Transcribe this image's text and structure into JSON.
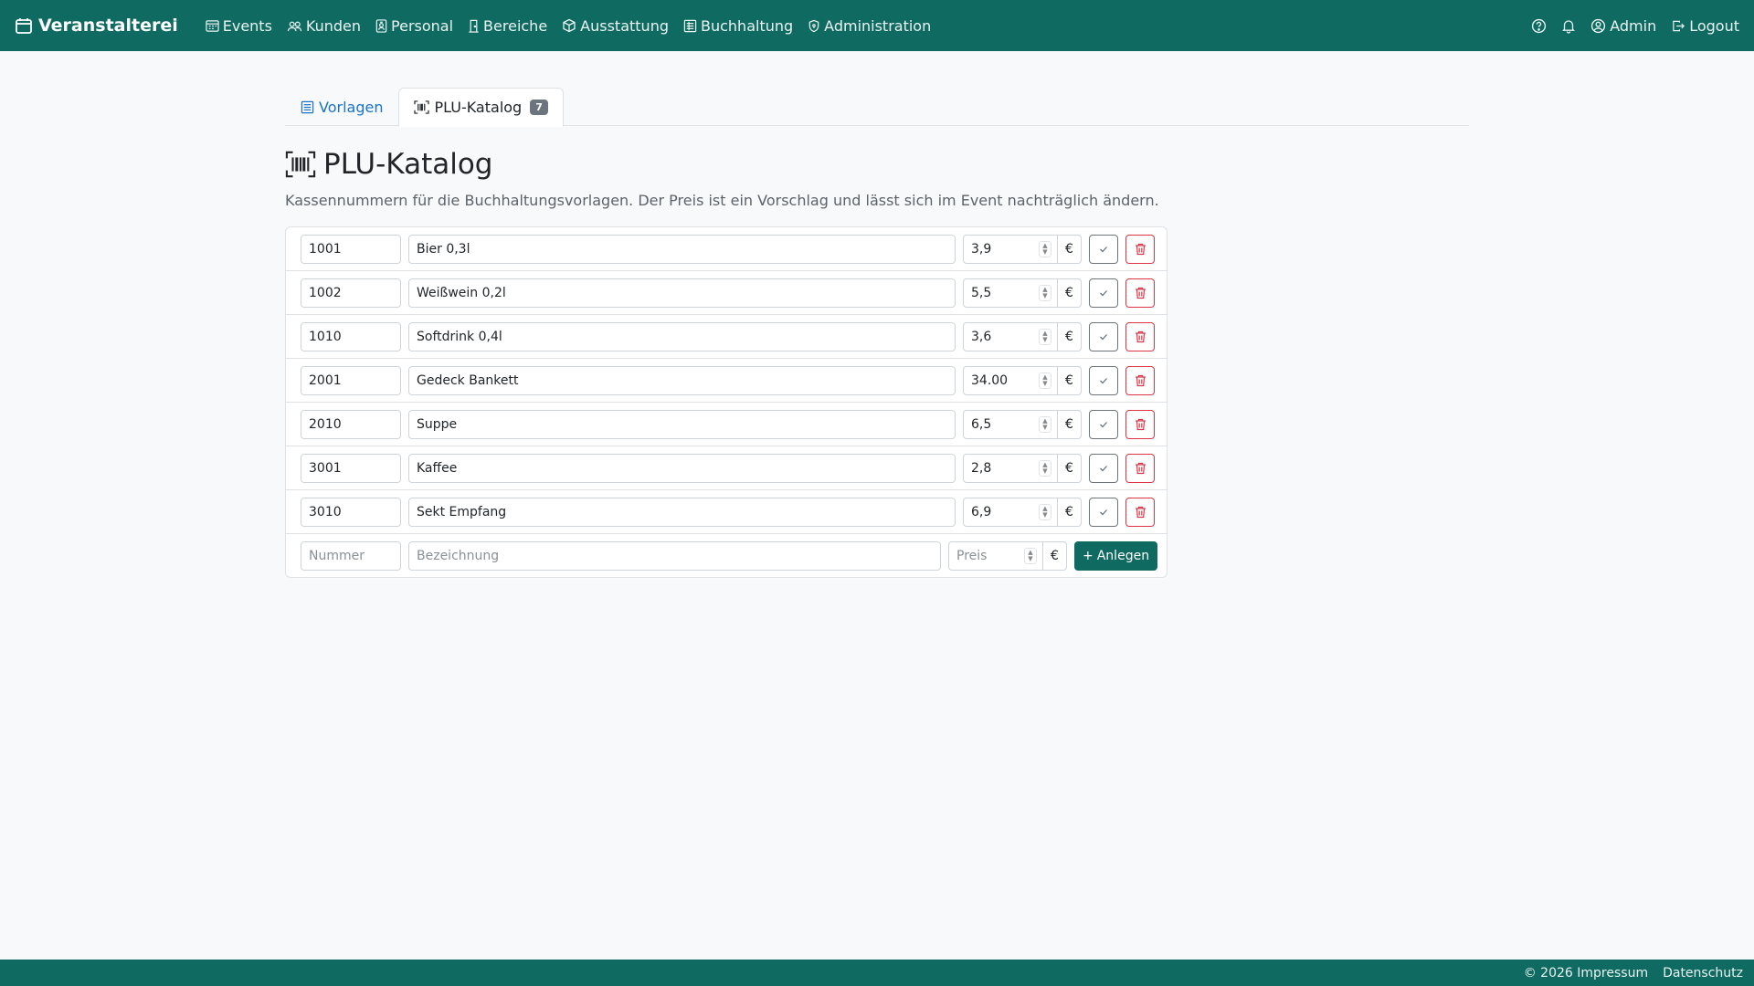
{
  "app": {
    "brand": "Veranstalterei",
    "accent_color": "#0f6b61"
  },
  "nav": {
    "items": [
      {
        "label": "Events",
        "icon": "calendar-grid-icon"
      },
      {
        "label": "Kunden",
        "icon": "people-icon"
      },
      {
        "label": "Personal",
        "icon": "badge-icon"
      },
      {
        "label": "Bereiche",
        "icon": "door-icon"
      },
      {
        "label": "Ausstattung",
        "icon": "box-icon"
      },
      {
        "label": "Buchhaltung",
        "icon": "ledger-icon"
      },
      {
        "label": "Administration",
        "icon": "shield-icon"
      }
    ],
    "user": "Admin",
    "logout": "Logout"
  },
  "tabs": {
    "vorlagen": "Vorlagen",
    "plu": "PLU-Katalog",
    "plu_count": "7"
  },
  "page": {
    "title": "PLU-Katalog",
    "subtitle": "Kassennummern für die Buchhaltungsvorlagen. Der Preis ist ein Vorschlag und lässt sich im Event nachträglich ändern."
  },
  "rows": [
    {
      "number": "1001",
      "name": "Bier 0,3l",
      "price": "3,9",
      "currency": "€"
    },
    {
      "number": "1002",
      "name": "Weißwein 0,2l",
      "price": "5,5",
      "currency": "€"
    },
    {
      "number": "1010",
      "name": "Softdrink 0,4l",
      "price": "3,6",
      "currency": "€"
    },
    {
      "number": "2001",
      "name": "Gedeck Bankett",
      "price": "34.00",
      "currency": "€"
    },
    {
      "number": "2010",
      "name": "Suppe",
      "price": "6,5",
      "currency": "€"
    },
    {
      "number": "3001",
      "name": "Kaffee",
      "price": "2,8",
      "currency": "€"
    },
    {
      "number": "3010",
      "name": "Sekt Empfang",
      "price": "6,9",
      "currency": "€"
    }
  ],
  "new_row": {
    "number_placeholder": "Nummer",
    "name_placeholder": "Bezeichnung",
    "price_placeholder": "Preis",
    "currency": "€",
    "add_label": "Anlegen",
    "add_prefix": "+"
  },
  "footer": {
    "copyright": "© 2026 Impressum",
    "privacy": "Datenschutz"
  }
}
